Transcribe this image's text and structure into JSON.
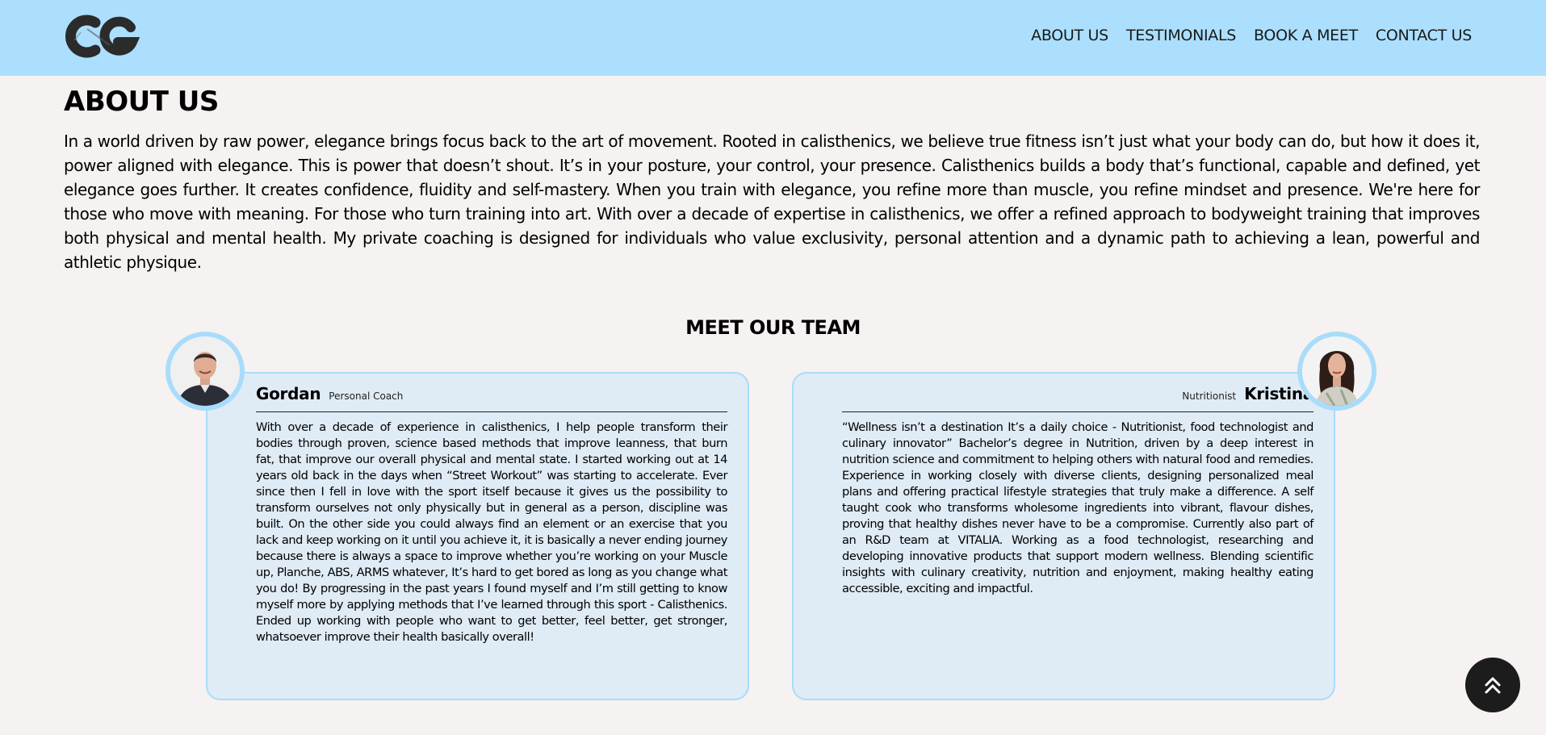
{
  "header": {
    "logo_icon": "cg-logo-icon",
    "nav": [
      {
        "label": "ABOUT US"
      },
      {
        "label": "TESTIMONIALS"
      },
      {
        "label": "BOOK A MEET"
      },
      {
        "label": "CONTACT US"
      }
    ]
  },
  "about": {
    "title": "ABOUT US",
    "text": "In a world driven by raw power, elegance brings focus back to the art of movement. Rooted in calisthenics, we believe true fitness isn’t just what your body can do, but how it does it, power aligned with elegance. This is power that doesn’t shout. It’s in your posture, your control, your presence. Calisthenics builds a body that’s functional, capable and defined, yet elegance goes further. It creates confidence, fluidity and self-mastery. When you train with elegance, you refine more than muscle, you refine mindset and presence. We're here for those who move with meaning. For those who turn training into art. With over a decade of expertise in calisthenics, we offer a refined approach to bodyweight training that improves both physical and mental health. My private coaching is designed for individuals who value exclusivity, personal attention and a dynamic path to achieving a lean, powerful and athletic physique."
  },
  "team": {
    "title": "MEET OUR TEAM",
    "members": [
      {
        "name": "Gordan",
        "role": "Personal Coach",
        "bio": "With over a decade of experience in calisthenics, I help people transform their bodies through proven, science based methods that improve leanness, that burn fat, that improve our overall physical and mental state. I started working out at 14 years old back in the days when “Street Workout” was starting to accelerate. Ever since then I fell in love with the sport itself because it gives us the possibility to transform ourselves not only physically but in general as a person, discipline was built. On the other side you could always find an element or an exercise that you lack and keep working on it until you achieve it, it is basically a never ending journey because there is always a space to improve whether you’re working on your Muscle up, Planche, ABS, ARMS whatever, It’s hard to get bored as long as you change what you do! By progressing in the past years I found myself and I’m still getting to know myself more by applying methods that I’ve learned through this sport - Calisthenics. Ended up working with people who want to get better, feel better, get stronger, whatsoever improve their health basically overall!"
      },
      {
        "name": "Kristina",
        "role": "Nutritionist",
        "bio": "“Wellness isn’t a destination It’s a daily choice - Nutritionist, food technologist and culinary innovator” Bachelor’s degree in Nutrition, driven by a deep interest in nutrition science and commitment to helping others with natural food and remedies. Experience in working closely with diverse clients, designing personalized meal plans and offering practical lifestyle strategies that truly make a difference. A self taught cook who transforms wholesome ingredients into vibrant, flavour dishes, proving that healthy dishes never have to be a compromise. Currently also part of an R&D team at VITALIA. Working as a food technologist, researching and developing innovative products that support modern wellness. Blending scientific insights with culinary creativity, nutrition and enjoyment, making healthy eating accessible, exciting and impactful."
      }
    ]
  },
  "scroll_top_icon": "double-chevron-up-icon",
  "colors": {
    "header_bg": "#abdffd",
    "page_bg": "#f5f2f1",
    "card_bg": "#dfebf5",
    "card_border": "#a9dcfb",
    "button_bg": "#1c1c1c"
  }
}
